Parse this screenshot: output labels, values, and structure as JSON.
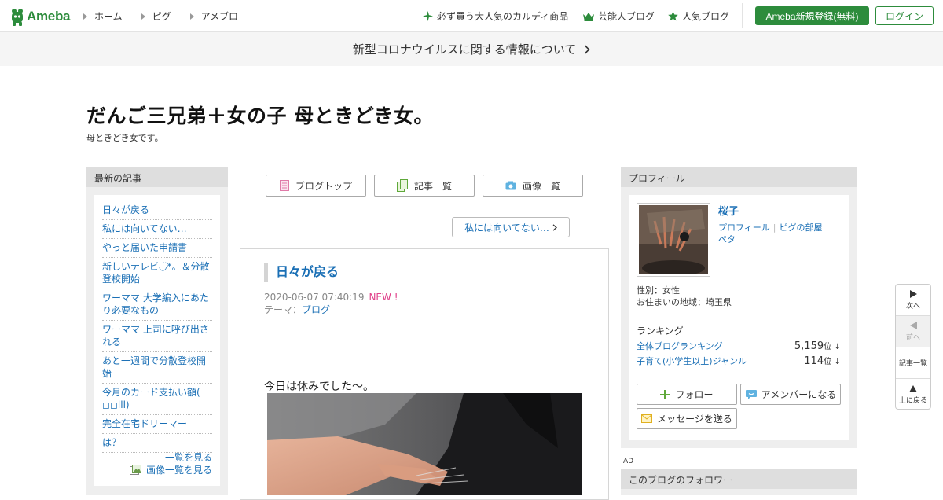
{
  "header": {
    "logo_text": "Ameba",
    "nav": [
      {
        "label": "ホーム"
      },
      {
        "label": "ピグ"
      },
      {
        "label": "アメブロ"
      }
    ],
    "promos": [
      {
        "label": "必ず買う大人気のカルディ商品",
        "icon": "sparkle-icon"
      },
      {
        "label": "芸能人ブログ",
        "icon": "crown-icon"
      },
      {
        "label": "人気ブログ",
        "icon": "star-icon"
      }
    ],
    "register_label": "Ameba新規登録(無料)",
    "login_label": "ログイン",
    "brand_color": "#2d8c3c"
  },
  "notice": {
    "text": "新型コロナウイルスに関する情報について"
  },
  "blog": {
    "title": "だんご三兄弟＋女の子 母ときどき女。",
    "description": "母ときどき女です。"
  },
  "recent": {
    "heading": "最新の記事",
    "items": [
      "日々が戻る",
      "私には向いてない…",
      "やっと届いた申請書",
      "新しいテレビ◡̈*。＆分散登校開始",
      "ワーママ 大学編入にあたり必要なもの",
      "ワーママ 上司に呼び出される",
      "あと一週間で分散登校開始",
      "今月のカード支払い額( ◻︎◻︎lll)",
      "完全在宅ドリーマー",
      "は？"
    ],
    "see_all": "一覧を見る",
    "see_images": "画像一覧を見る"
  },
  "toolbar": {
    "blog_top": "ブログトップ",
    "entry_list": "記事一覧",
    "image_list": "画像一覧"
  },
  "next_entry": "私には向いてない…",
  "entry": {
    "title": "日々が戻る",
    "datetime": "2020-06-07 07:40:19",
    "new_badge": "NEW !",
    "theme_label": "テーマ：",
    "theme": "ブログ",
    "body": "今日は休みでした〜。"
  },
  "profile": {
    "heading": "プロフィール",
    "name": "桜子",
    "link_profile": "プロフィール",
    "link_pig": "ピグの部屋",
    "link_peta": "ペタ",
    "gender": "性別：女性",
    "region": "お住まいの地域：埼玉県",
    "ranking_heading": "ランキング",
    "rankings": [
      {
        "label": "全体ブログランキング",
        "value": "5,159",
        "unit": "位",
        "trend": "↓"
      },
      {
        "label": "子育て(小学生以上)ジャンル",
        "value": "114",
        "unit": "位",
        "trend": "↓"
      }
    ],
    "follow": "フォロー",
    "amember": "アメンバーになる",
    "message": "メッセージを送る"
  },
  "ad_label": "AD",
  "followers_heading": "このブログのフォロワー",
  "float_nav": {
    "next": "次へ",
    "prev": "前へ",
    "list": "記事一覧",
    "top": "上に戻る"
  }
}
